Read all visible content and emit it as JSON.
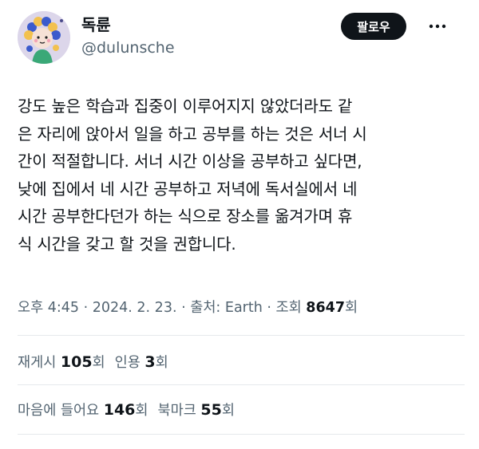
{
  "user": {
    "display_name": "독륜",
    "handle": "@dulunsche"
  },
  "follow_label": "팔로우",
  "tweet": {
    "lines": [
      "강도 높은 학습과 집중이 이루어지지 않았더라도 같",
      "은 자리에 앉아서 일을 하고 공부를 하는 것은 서너 시",
      "간이 적절합니다. 서너 시간 이상을 공부하고 싶다면,",
      "낮에 집에서 네 시간 공부하고 저녁에 독서실에서 네",
      "시간 공부한다던가 하는 식으로 장소를 옮겨가며 휴",
      "식 시간을 갖고 할 것을 권합니다."
    ]
  },
  "meta": {
    "time": "오후 4:45",
    "sep1": " · ",
    "date": "2024. 2. 23.",
    "sep2": " · ",
    "source": "출처: Earth",
    "sep3": " · ",
    "views_label": "조회 ",
    "views_count": "8647",
    "views_suffix": "회"
  },
  "stats": {
    "reposts_label": "재게시 ",
    "reposts_count": "105",
    "reposts_suffix": "회",
    "quotes_label": "인용 ",
    "quotes_count": "3",
    "quotes_suffix": "회",
    "likes_label": "마음에 들어요 ",
    "likes_count": "146",
    "likes_suffix": "회",
    "bookmarks_label": "북마크 ",
    "bookmarks_count": "55",
    "bookmarks_suffix": "회"
  },
  "colors": {
    "text": "#0f1419",
    "secondary": "#536471",
    "follow_bg": "#0f1419",
    "divider": "#e6e9ec",
    "avatar_bg": "#dcd6ea"
  },
  "icons": {
    "more": "more-horizontal-icon",
    "avatar": "character-avatar-illustration"
  }
}
